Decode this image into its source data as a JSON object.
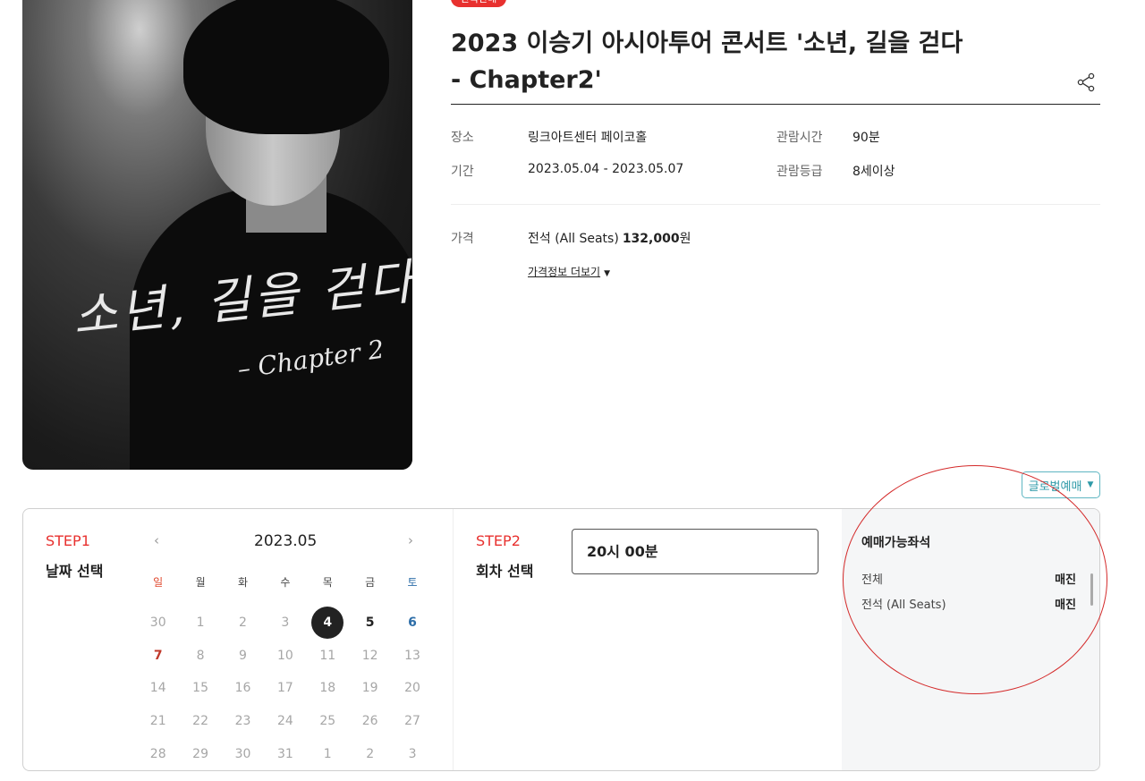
{
  "badge": "단독판매",
  "title": "2023 이승기 아시아투어 콘서트 '소년, 길을 걷다 - Chapter2'",
  "poster": {
    "sig_main": "소년, 길을 걷다",
    "sig_sub": "– Chapter 2"
  },
  "info": {
    "venue_label": "장소",
    "venue_value": "링크아트센터 페이코홀",
    "period_label": "기간",
    "period_value": "2023.05.04 - 2023.05.07",
    "runtime_label": "관람시간",
    "runtime_value": "90분",
    "rating_label": "관람등급",
    "rating_value": "8세이상",
    "price_label": "가격",
    "price_seat": "전석 (All Seats)",
    "price_amount": "132,000",
    "price_unit": "원",
    "price_more": "가격정보 더보기"
  },
  "global_booking": "글로벌예매",
  "step1": {
    "label": "STEP1",
    "title": "날짜 선택"
  },
  "calendar": {
    "month": "2023.05",
    "weekdays": [
      "일",
      "월",
      "화",
      "수",
      "목",
      "금",
      "토"
    ],
    "days": [
      "30",
      "1",
      "2",
      "3",
      "4",
      "5",
      "6",
      "7",
      "8",
      "9",
      "10",
      "11",
      "12",
      "13",
      "14",
      "15",
      "16",
      "17",
      "18",
      "19",
      "20",
      "21",
      "22",
      "23",
      "24",
      "25",
      "26",
      "27",
      "28",
      "29",
      "30",
      "31",
      "1",
      "2",
      "3"
    ],
    "selected_day": "4",
    "available_days": [
      "4",
      "5",
      "6",
      "7"
    ]
  },
  "step2": {
    "label": "STEP2",
    "title": "회차 선택",
    "session": "20시 00분"
  },
  "seats": {
    "title": "예매가능좌석",
    "rows": [
      {
        "name": "전체",
        "status": "매진"
      },
      {
        "name": "전석 (All Seats)",
        "status": "매진"
      }
    ]
  },
  "colors": {
    "accent": "#e8312f",
    "teal": "#2f9aa8",
    "sunday": "#c0392b",
    "saturday": "#2d6ea8"
  }
}
